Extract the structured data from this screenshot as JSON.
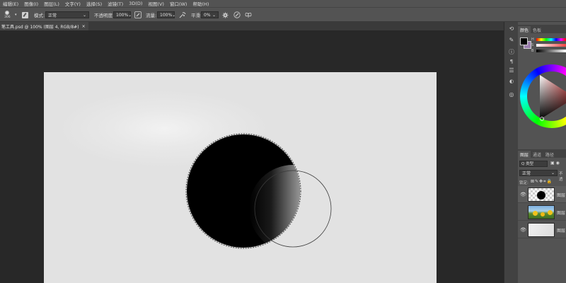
{
  "menu": [
    "编辑(E)",
    "图像(I)",
    "图层(L)",
    "文字(Y)",
    "选择(S)",
    "滤镜(T)",
    "3D(D)",
    "视图(V)",
    "窗口(W)",
    "帮助(H)"
  ],
  "options": {
    "brush_size": "306",
    "mode_label": "模式:",
    "mode_value": "正常",
    "opacity_label": "不透明度:",
    "opacity_value": "100%",
    "flow_label": "流量:",
    "flow_value": "100%",
    "smooth_label": "平滑:",
    "smooth_value": "0%"
  },
  "document_tab": {
    "title": "笔工具.psd @ 100% (图层 4, RGB/8#)",
    "close": "×"
  },
  "color_panel": {
    "tabs": [
      "颜色",
      "色板"
    ],
    "slider_labels": [
      "H",
      "S",
      "B"
    ],
    "foreground_color": "#000000",
    "background_color": "#9b7fae"
  },
  "layers_panel": {
    "tabs": [
      "图层",
      "通道",
      "路径"
    ],
    "filter_label": "Q 类型",
    "blend_mode": "正常",
    "opacity_short": "不透",
    "lock_label": "锁定:",
    "layers": [
      {
        "name": "图层",
        "visible": true,
        "kind": "circle"
      },
      {
        "name": "图层",
        "visible": false,
        "kind": "sunflowers"
      },
      {
        "name": "图层",
        "visible": true,
        "kind": "gray"
      }
    ]
  },
  "colors": {
    "ui_dark": "#282828",
    "panel": "#535353",
    "canvas": "#e2e2e2",
    "accent_purple": "#9b7fae"
  }
}
